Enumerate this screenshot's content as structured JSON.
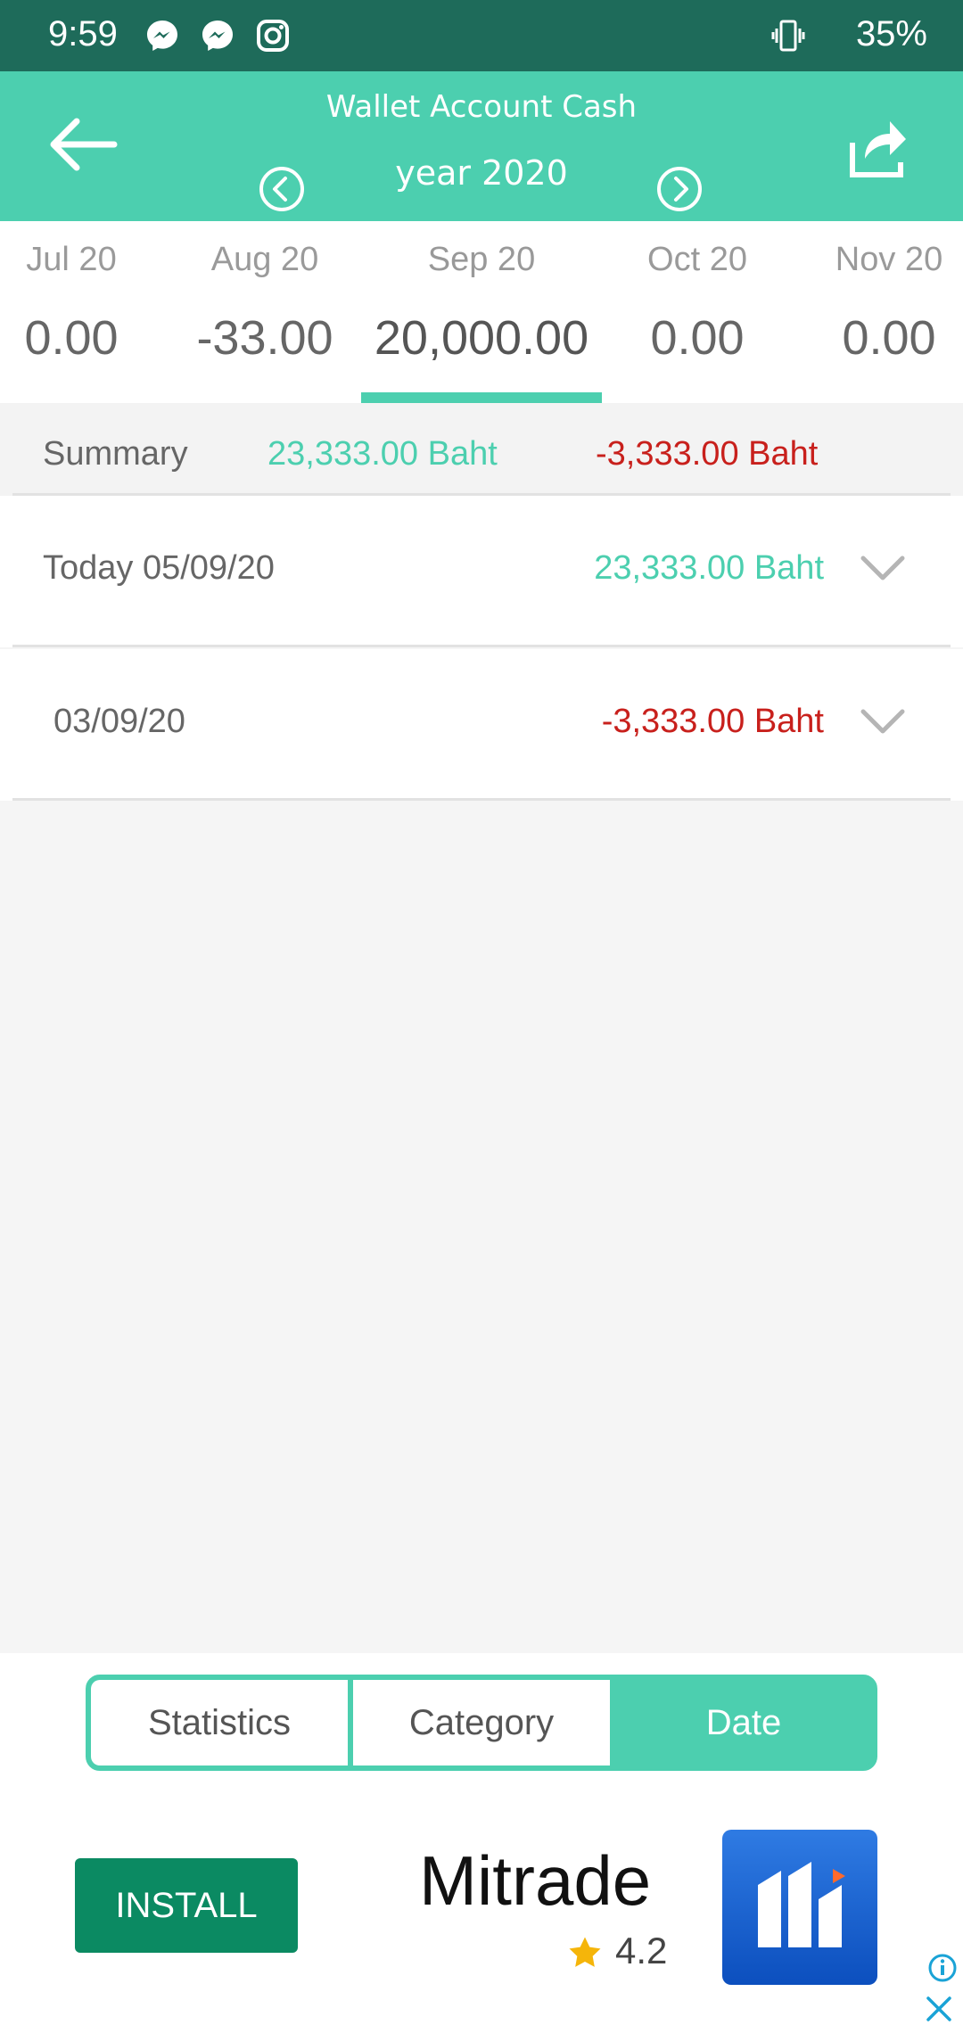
{
  "status_bar": {
    "time": "9:59",
    "battery": "35%"
  },
  "header": {
    "title": "Wallet Account Cash",
    "year": "year 2020"
  },
  "months": [
    {
      "label": "Jul 20",
      "value": "0.00"
    },
    {
      "label": "Aug 20",
      "value": "-33.00"
    },
    {
      "label": "Sep 20",
      "value": "20,000.00"
    },
    {
      "label": "Oct 20",
      "value": "0.00"
    },
    {
      "label": "Nov 20",
      "value": "0.00"
    }
  ],
  "selected_month": "Sep 20",
  "summary": {
    "label": "Summary",
    "income": "23,333.00 Baht",
    "expense": "-3,333.00 Baht"
  },
  "dates": [
    {
      "label": "Today 05/09/20",
      "amount": "23,333.00 Baht"
    },
    {
      "label": "03/09/20",
      "amount": "-3,333.00 Baht"
    }
  ],
  "tabs": {
    "statistics": "Statistics",
    "category": "Category",
    "date": "Date",
    "active": "Date"
  },
  "ad": {
    "install": "INSTALL",
    "name": "Mitrade",
    "rating": "4.2"
  },
  "colors": {
    "accent": "#4ccfaf",
    "status_bar": "#1e6b5a",
    "income": "#4ccfaf",
    "expense": "#c8201c",
    "install": "#0b8a62"
  }
}
